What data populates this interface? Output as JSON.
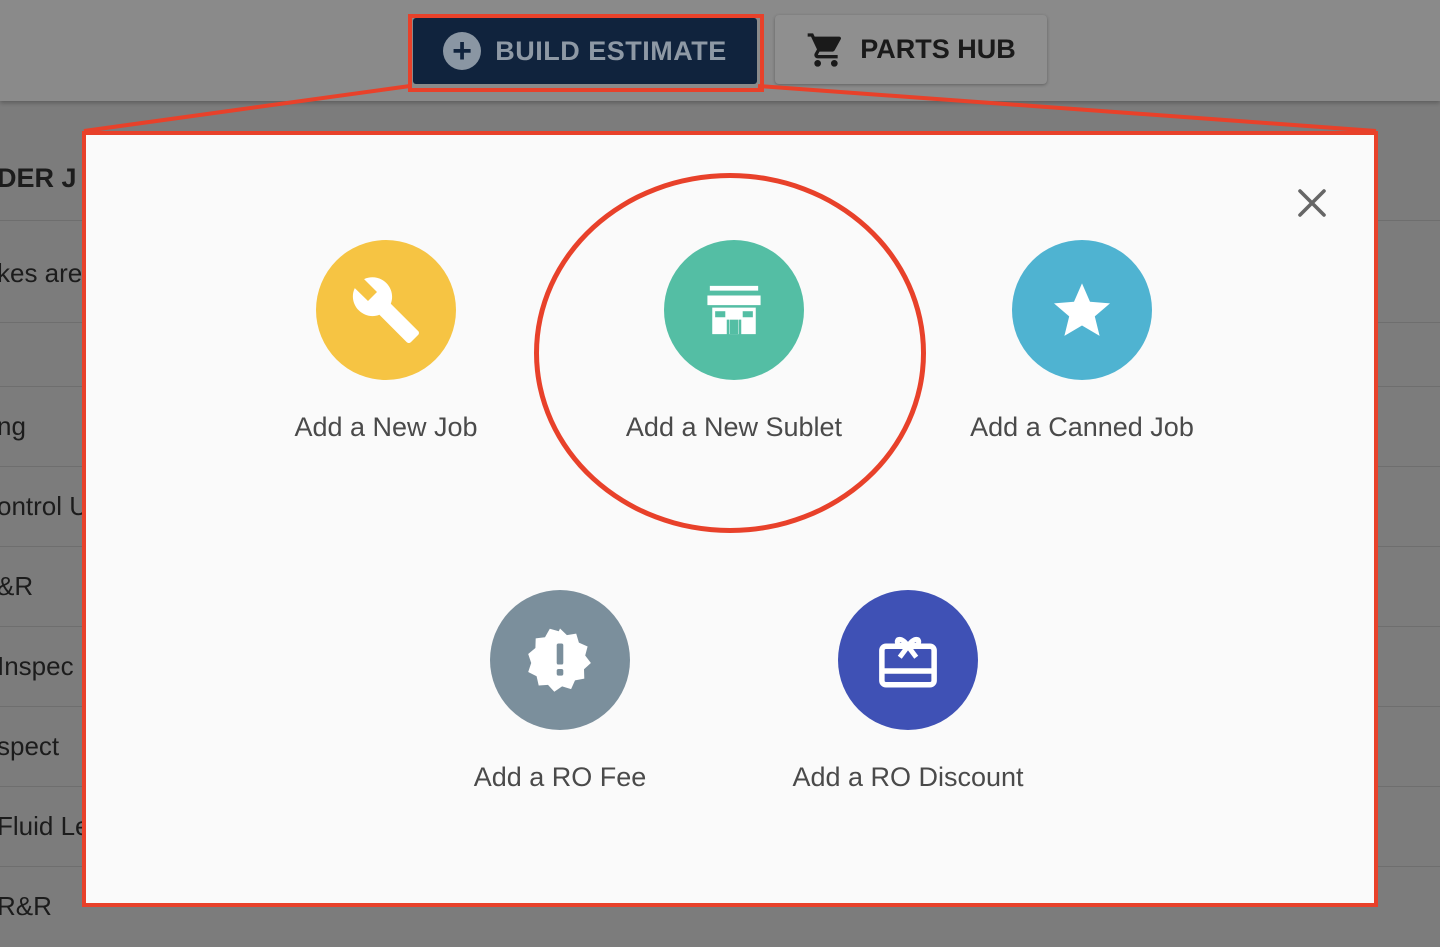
{
  "toolbar": {
    "build_estimate_label": "BUILD ESTIMATE",
    "parts_hub_label": "PARTS HUB"
  },
  "background": {
    "header_fragment": "DER J",
    "rows": [
      "kes are",
      "ng",
      "ontrol U",
      "&R",
      " Inspec",
      "spect",
      "Fluid Le",
      "R&R"
    ]
  },
  "modal": {
    "options": [
      {
        "label": "Add a New Job",
        "icon": "wrench-icon",
        "color": "#f6c443"
      },
      {
        "label": "Add a New Sublet",
        "icon": "storefront-icon",
        "color": "#54bea4"
      },
      {
        "label": "Add a Canned Job",
        "icon": "star-icon",
        "color": "#4fb3d1"
      },
      {
        "label": "Add a RO Fee",
        "icon": "alert-badge-icon",
        "color": "#7b8f9c"
      },
      {
        "label": "Add a RO Discount",
        "icon": "gift-card-icon",
        "color": "#3f51b5"
      }
    ]
  },
  "colors": {
    "highlight": "#e8412a",
    "primary_button": "#10233d",
    "modal_bg": "#fafafa"
  }
}
